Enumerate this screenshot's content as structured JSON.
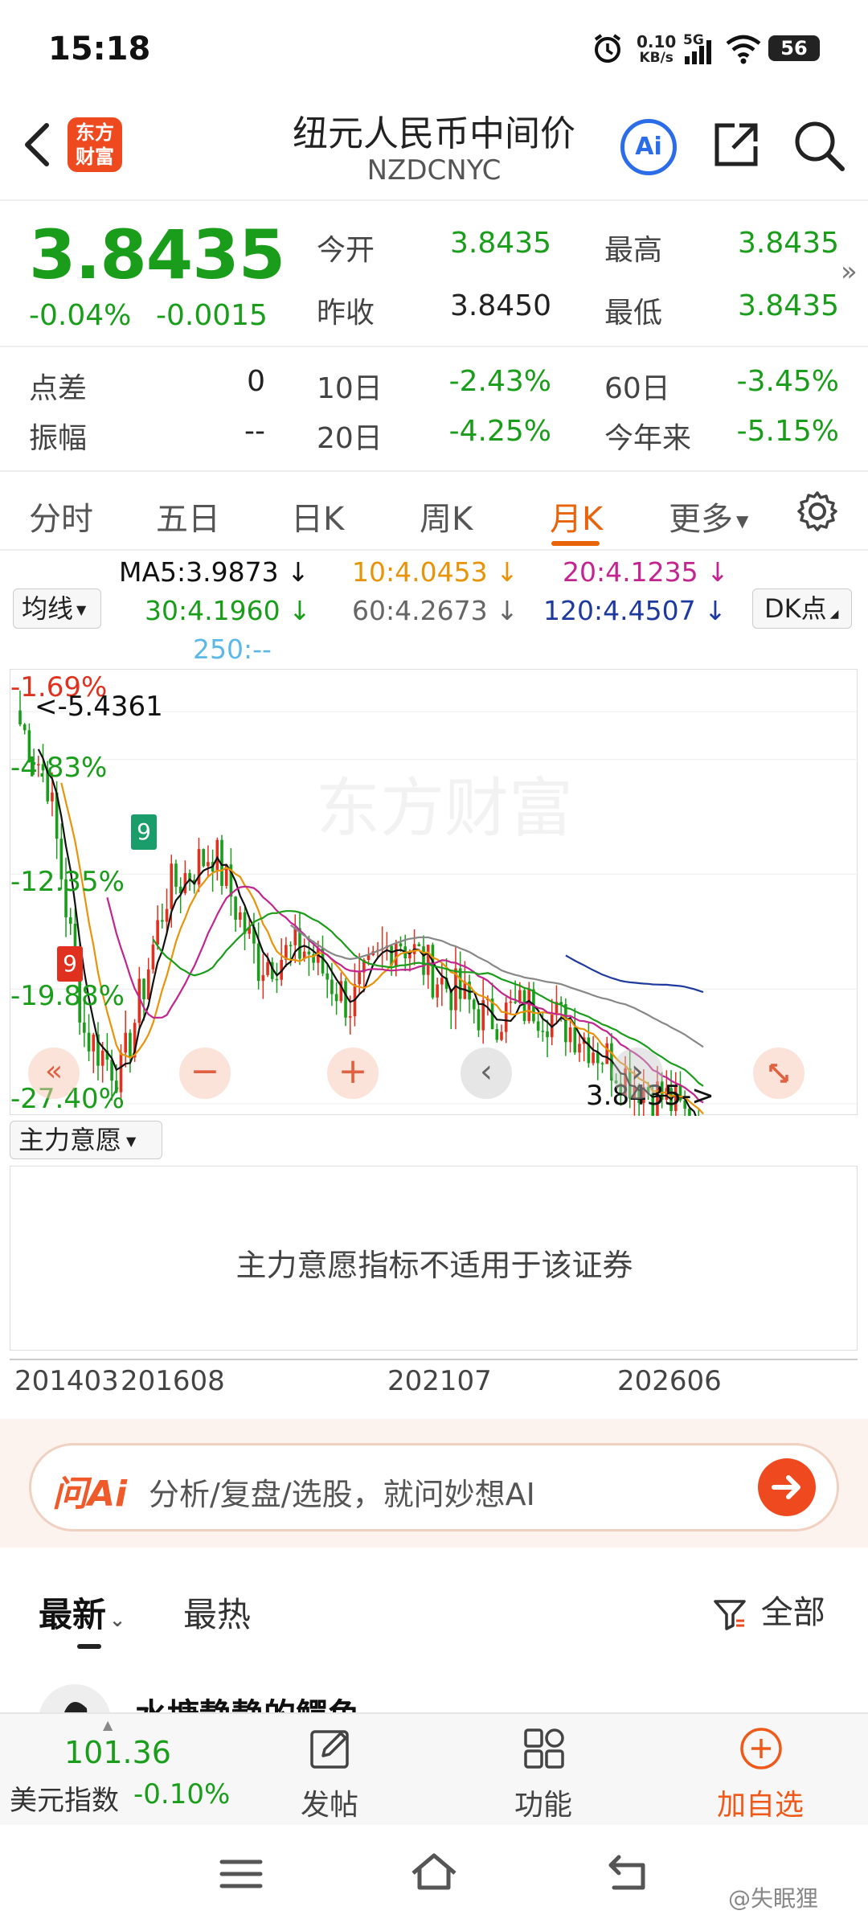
{
  "status_bar": {
    "time": "15:18",
    "net_speed": "0.10",
    "net_unit": "KB/s",
    "signal_label": "5G",
    "battery": "56"
  },
  "header": {
    "title": "纽元人民币中间价",
    "code": "NZDCNYC",
    "logo_text_1": "东方",
    "logo_text_2": "财富",
    "ai_label": "Ai"
  },
  "quote": {
    "price": "3.8435",
    "change_pct": "-0.04%",
    "change": "-0.0015",
    "open_label": "今开",
    "open": "3.8435",
    "high_label": "最高",
    "high": "3.8435",
    "prev_close_label": "昨收",
    "prev_close": "3.8450",
    "low_label": "最低",
    "low": "3.8435",
    "spread_label": "点差",
    "spread": "0",
    "d10_label": "10日",
    "d10": "-2.43%",
    "d60_label": "60日",
    "d60": "-3.45%",
    "amplitude_label": "振幅",
    "amplitude": "--",
    "d20_label": "20日",
    "d20": "-4.25%",
    "ytd_label": "今年来",
    "ytd": "-5.15%"
  },
  "tabs": [
    "分时",
    "五日",
    "日K",
    "周K",
    "月K",
    "更多"
  ],
  "active_tab": "月K",
  "ma": {
    "selector": "均线",
    "ma5": "MA5:3.9873",
    "ma10": "10:4.0453",
    "ma20": "20:4.1235",
    "ma30": "30:4.1960",
    "ma60": "60:4.2673",
    "ma120": "120:4.4507",
    "ma250": "250:--",
    "dk": "DK点",
    "arrow": "↓"
  },
  "chart": {
    "pct_labels": [
      "-1.69%",
      "-4.83%",
      "-12.35%",
      "-19.88%",
      "-27.40%"
    ],
    "max_marker": "<-5.4361",
    "last_marker": "3.8435->",
    "x_labels": [
      "201403",
      "201608",
      "202107",
      "202606"
    ],
    "watermark": "东方财富",
    "signal_9": "9",
    "colors": {
      "up": "#e0301e",
      "down": "#1a9d1a",
      "ma5": "#111111",
      "ma10": "#e8940a",
      "ma20": "#c2258f",
      "ma30": "#1a9d1a",
      "ma60": "#888888",
      "ma120": "#1f3a9e"
    }
  },
  "chart_data": {
    "type": "line",
    "title": "",
    "xlabel": "",
    "ylabel": "",
    "x": [
      "201403",
      "201608",
      "202107",
      "202606"
    ],
    "series": [
      {
        "name": "MA5",
        "latest": 3.9873
      },
      {
        "name": "10",
        "latest": 4.0453
      },
      {
        "name": "20",
        "latest": 4.1235
      },
      {
        "name": "30",
        "latest": 4.196
      },
      {
        "name": "60",
        "latest": 4.2673
      },
      {
        "name": "120",
        "latest": 4.4507
      }
    ],
    "max_price": 5.4361,
    "last_price": 3.8435,
    "y_pct_ticks": [
      -1.69,
      -4.83,
      -12.35,
      -19.88,
      -27.4
    ],
    "grid": true
  },
  "indicator": {
    "selector": "主力意愿",
    "message": "主力意愿指标不适用于该证券"
  },
  "ai": {
    "brand": "问Ai",
    "placeholder": "分析/复盘/选股，就问妙想AI"
  },
  "feed": {
    "tab_latest": "最新",
    "tab_hot": "最热",
    "filter": "全部",
    "first_author": "水塘静静的鳄鱼"
  },
  "bottom_bar": {
    "index_value": "101.36",
    "index_name": "美元指数",
    "index_change": "-0.10%",
    "post": "发帖",
    "functions": "功能",
    "add_watch": "加自选"
  },
  "watermark_user": "@失眠狸"
}
